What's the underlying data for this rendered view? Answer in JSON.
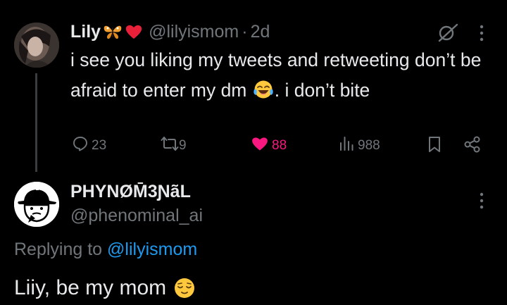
{
  "parent_tweet": {
    "author_name": "Lily",
    "name_emojis": [
      "butterfly-icon",
      "red-heart-icon"
    ],
    "handle": "@lilyismom",
    "separator": "·",
    "time": "2d",
    "text_part1": "i see you liking my tweets and retweeting don’t be afraid to enter my dm",
    "text_emoji": "face-with-tears-of-joy",
    "text_part2": ". i don’t bite",
    "actions": {
      "replies": "23",
      "retweets": "9",
      "likes": "88",
      "views": "988"
    },
    "colors": {
      "like": "#f91880",
      "muted": "#71767b"
    }
  },
  "reply_tweet": {
    "author_name": "PHYNØM̄3ƝãL",
    "handle": "@phenominal_ai",
    "replying_label": "Replying to",
    "replying_to": "@lilyismom",
    "text": "Liiy, be my mom",
    "text_emoji": "relieved-face",
    "colors": {
      "mention": "#1d9bf0"
    }
  }
}
